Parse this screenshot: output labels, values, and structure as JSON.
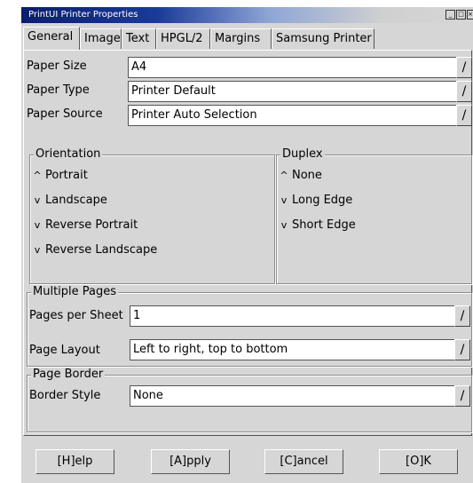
{
  "window": {
    "title": "PrintUI Printer Properties",
    "controls": [
      "_",
      "□",
      "×"
    ]
  },
  "tabs": [
    {
      "label": "General",
      "active": true
    },
    {
      "label": "Image",
      "active": false
    },
    {
      "label": "Text",
      "active": false
    },
    {
      "label": "HPGL/2",
      "active": false
    },
    {
      "label": "Margins",
      "active": false
    },
    {
      "label": "Samsung Printer",
      "active": false
    }
  ],
  "paper": {
    "size_label": "Paper Size",
    "size_value": "A4",
    "type_label": "Paper Type",
    "type_value": "Printer Default",
    "source_label": "Paper Source",
    "source_value": "Printer Auto Selection"
  },
  "orientation": {
    "legend": "Orientation",
    "options": [
      {
        "label": "Portrait",
        "selected": true
      },
      {
        "label": "Landscape",
        "selected": false
      },
      {
        "label": "Reverse Portrait",
        "selected": false
      },
      {
        "label": "Reverse Landscape",
        "selected": false
      }
    ]
  },
  "duplex": {
    "legend": "Duplex",
    "options": [
      {
        "label": "None",
        "selected": true
      },
      {
        "label": "Long Edge",
        "selected": false
      },
      {
        "label": "Short Edge",
        "selected": false
      }
    ]
  },
  "multiple_pages": {
    "legend": "Multiple Pages",
    "per_sheet_label": "Pages per Sheet",
    "per_sheet_value": "1",
    "layout_label": "Page Layout",
    "layout_value": "Left to right, top to bottom"
  },
  "page_border": {
    "legend": "Page Border",
    "style_label": "Border Style",
    "style_value": "None"
  },
  "combo_arrow": "/",
  "radio_marks": {
    "selected": "^",
    "unselected": "v"
  },
  "buttons": {
    "help": "[H]elp",
    "apply": "[A]pply",
    "cancel": "[C]ancel",
    "ok": "[O]K"
  }
}
